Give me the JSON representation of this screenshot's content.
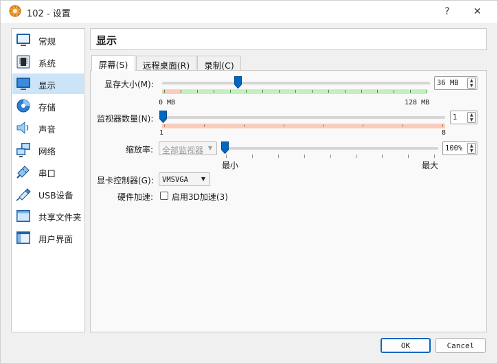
{
  "window": {
    "title": "102 - 设置",
    "help_glyph": "?",
    "close_glyph": "✕"
  },
  "sidebar": {
    "items": [
      {
        "label": "常规",
        "icon": "general-icon"
      },
      {
        "label": "系统",
        "icon": "system-chip-icon"
      },
      {
        "label": "显示",
        "icon": "display-monitor-icon",
        "selected": true
      },
      {
        "label": "存储",
        "icon": "storage-disk-icon"
      },
      {
        "label": "声音",
        "icon": "speaker-icon"
      },
      {
        "label": "网络",
        "icon": "network-icon"
      },
      {
        "label": "串口",
        "icon": "serial-port-icon"
      },
      {
        "label": "USB设备",
        "icon": "usb-icon"
      },
      {
        "label": "共享文件夹",
        "icon": "shared-folder-icon"
      },
      {
        "label": "用户界面",
        "icon": "user-interface-icon"
      }
    ]
  },
  "main": {
    "page_title": "显示",
    "tabs": [
      {
        "label": "屏幕(S)",
        "active": true
      },
      {
        "label": "远程桌面(R)"
      },
      {
        "label": "录制(C)"
      }
    ],
    "video_memory": {
      "label": "显存大小(M):",
      "value": "36 MB",
      "slider_fraction": 0.28,
      "min_label": "0 MB",
      "max_label": "128 MB"
    },
    "monitor_count": {
      "label": "监视器数量(N):",
      "value": "1",
      "slider_fraction": 0.0,
      "min_label": "1",
      "max_label": "8"
    },
    "scale_factor": {
      "label": "缩放率:",
      "monitor_select": "全部监视器",
      "value": "100%",
      "slider_fraction": 0.0,
      "min_label": "最小",
      "max_label": "最大"
    },
    "graphics_controller": {
      "label": "显卡控制器(G):",
      "value": "VMSVGA"
    },
    "acceleration": {
      "label": "硬件加速:",
      "checkbox_label": "启用3D加速(3)",
      "checked": false
    }
  },
  "footer": {
    "ok_label": "OK",
    "cancel_label": "Cancel"
  },
  "colors": {
    "accent": "#0067c0",
    "selected_bg": "#cce4f7",
    "zone_green": "#c6efc0",
    "zone_red": "#f9cdbb"
  }
}
